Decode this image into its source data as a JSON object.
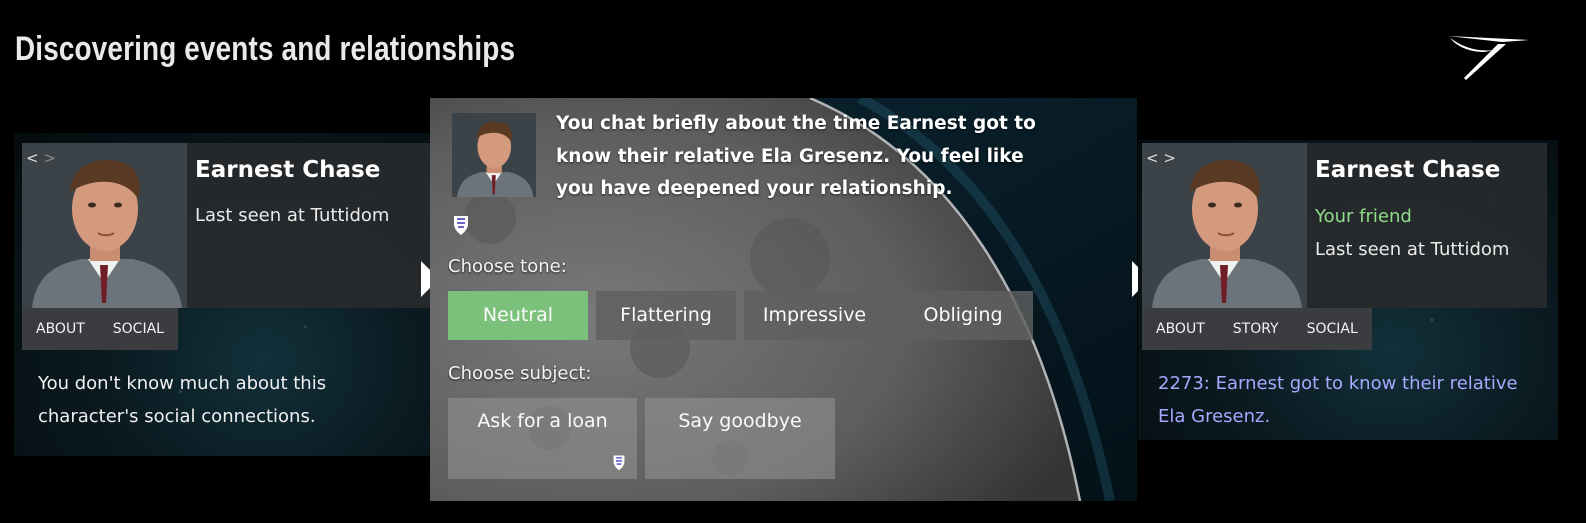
{
  "page": {
    "title": "Discovering events and relationships"
  },
  "left_card": {
    "nav_prev": "<",
    "nav_next": ">",
    "name": "Earnest Chase",
    "last_seen": "Last seen at Tuttidom",
    "tabs": [
      "ABOUT",
      "SOCIAL"
    ],
    "social_text": "You don't know much about this character's social connections."
  },
  "dialog": {
    "message": "You chat briefly about the time Earnest got to know their relative Ela Gresenz. You feel like you have deepened your relationship.",
    "tone_label": "Choose tone:",
    "tones": [
      "Neutral",
      "Flattering",
      "Impressive",
      "Obliging"
    ],
    "selected_tone": "Neutral",
    "subject_label": "Choose subject:",
    "subjects": [
      "Ask for a loan",
      "Say goodbye"
    ]
  },
  "right_card": {
    "nav_prev": "<",
    "nav_next": ">",
    "name": "Earnest Chase",
    "relationship": "Your friend",
    "last_seen": "Last seen at Tuttidom",
    "tabs": [
      "ABOUT",
      "STORY",
      "SOCIAL"
    ],
    "story_text": "2273: Earnest got to know their relative Ela Gresenz."
  },
  "colors": {
    "selected_tone": "#7cc17b",
    "friend": "#8fdc8a",
    "story": "#a8a8ff",
    "background": "#000000"
  },
  "icons": [
    "logo-icon",
    "portrait-image",
    "shield-icon",
    "arrow-right-icon"
  ]
}
